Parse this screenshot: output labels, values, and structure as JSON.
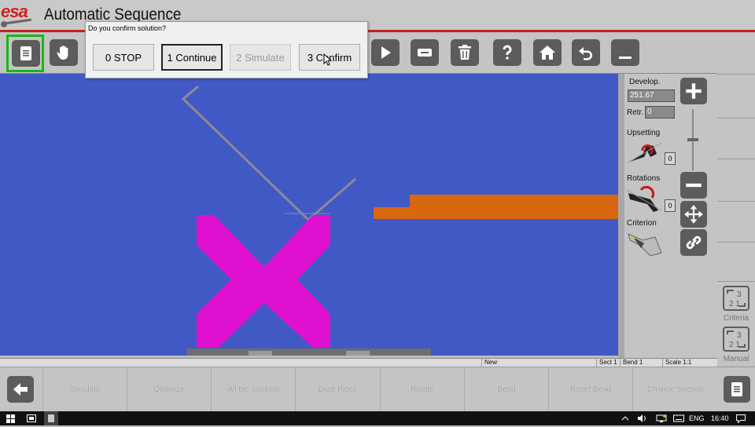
{
  "app": {
    "logo_text": "esa",
    "title": "Automatic Sequence"
  },
  "dialog": {
    "title": "Do you confirm solution?",
    "buttons": [
      {
        "label": "0 STOP",
        "state": "normal"
      },
      {
        "label": "1 Continue",
        "state": "focused"
      },
      {
        "label": "2 Simulate",
        "state": "disabled"
      },
      {
        "label": "3 Confirm",
        "state": "normal"
      }
    ]
  },
  "toolbar": {
    "icons": [
      "document-icon",
      "hand-icon",
      "play-icon",
      "minus-card-icon",
      "trash-icon",
      "help-icon",
      "home-icon",
      "undo-icon",
      "minimize-icon"
    ]
  },
  "properties": {
    "develop_label": "Develop.",
    "develop_value": "251.67",
    "retr_label": "Retr.",
    "retr_value": "0",
    "upsetting_label": "Upsetting",
    "upsetting_value": "0",
    "rotations_label": "Rotations",
    "rotations_value": "0",
    "criterion_label": "Criterion"
  },
  "right_column": {
    "criteria_label": "Criteria",
    "manual_label": "Manual"
  },
  "status_bar": {
    "mode": "New",
    "section": "Sect 1",
    "bend": "Bend 1",
    "scale": "Scale 1:1"
  },
  "bottom_bar": {
    "buttons": [
      "Simulate",
      "Optimize",
      "All the solution",
      "Draft Piece",
      "Rotate",
      "Bend",
      "Reset Bend",
      "Change Section"
    ]
  },
  "taskbar": {
    "language": "ENG",
    "time": "16:40"
  },
  "colors": {
    "canvas": "#4159c4",
    "tool": "#e010d0",
    "part": "#d8680f",
    "accent_red": "#c82020",
    "selected_green": "#16b816"
  }
}
